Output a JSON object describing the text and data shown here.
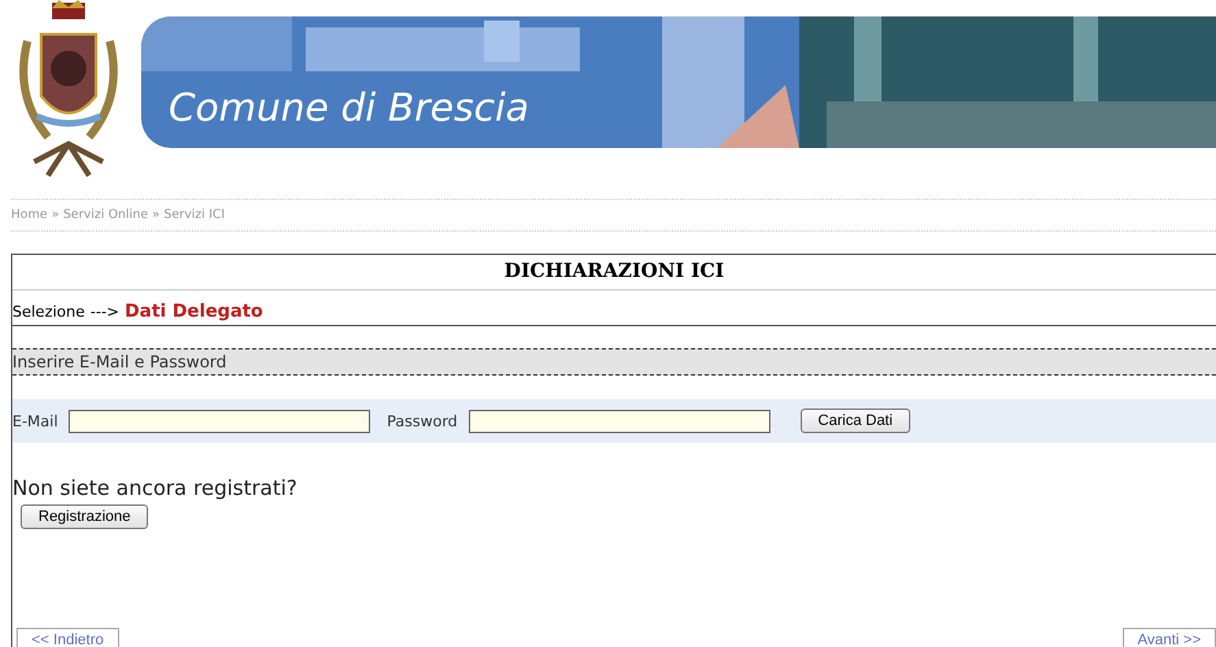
{
  "header": {
    "banner_title": "Comune di Brescia"
  },
  "breadcrumb": [
    "Home",
    "Servizi Online",
    "Servizi ICI"
  ],
  "breadcrumb_separator": "»",
  "title": "DICHIARAZIONI ICI",
  "steps": {
    "previous": "Selezione",
    "arrow": "--->",
    "current": "Dati Delegato"
  },
  "section_label": "Inserire E-Mail e Password",
  "form": {
    "fields": [
      {
        "label": "E-Mail"
      },
      {
        "label": "Password"
      }
    ],
    "button": "Carica Dati"
  },
  "register": {
    "question": "Non siete ancora registrati?",
    "button": "Registrazione"
  },
  "nav": {
    "back": "<< Indietro",
    "next": "Avanti >>"
  }
}
